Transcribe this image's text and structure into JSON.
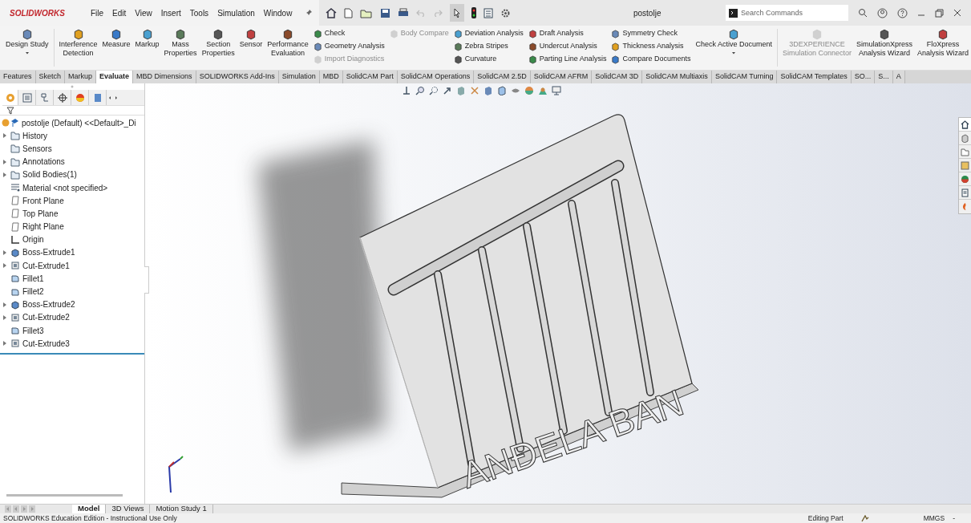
{
  "app": {
    "logo": "SOLIDWORKS",
    "menus": [
      "File",
      "Edit",
      "View",
      "Insert",
      "Tools",
      "Simulation",
      "Window"
    ],
    "title": "postolje",
    "search": {
      "placeholder": "Search Commands"
    }
  },
  "ribbon": [
    {
      "kind": "large",
      "lines": [
        "Design Study"
      ],
      "dropdown": true,
      "disabled": false
    },
    {
      "kind": "large",
      "lines": [
        "Interference",
        "Detection"
      ],
      "dropdown": false,
      "disabled": false
    },
    {
      "kind": "large",
      "lines": [
        "Measure"
      ],
      "dropdown": false,
      "disabled": false
    },
    {
      "kind": "large",
      "lines": [
        "Markup"
      ],
      "dropdown": false,
      "disabled": false
    },
    {
      "kind": "large",
      "lines": [
        "Mass",
        "Properties"
      ],
      "dropdown": false,
      "disabled": false
    },
    {
      "kind": "large",
      "lines": [
        "Section",
        "Properties"
      ],
      "dropdown": false,
      "disabled": false
    },
    {
      "kind": "large",
      "lines": [
        "Sensor"
      ],
      "dropdown": false,
      "disabled": false
    },
    {
      "kind": "large",
      "lines": [
        "Performance",
        "Evaluation"
      ],
      "dropdown": false,
      "disabled": false
    },
    {
      "kind": "column",
      "items": [
        {
          "label": "Check",
          "disabled": false
        },
        {
          "label": "Geometry Analysis",
          "disabled": false
        },
        {
          "label": "Import Diagnostics",
          "disabled": true
        }
      ]
    },
    {
      "kind": "column",
      "items": [
        {
          "label": "Body Compare",
          "disabled": true
        }
      ]
    },
    {
      "kind": "column",
      "items": [
        {
          "label": "Deviation Analysis",
          "disabled": false
        },
        {
          "label": "Zebra Stripes",
          "disabled": false
        },
        {
          "label": "Curvature",
          "disabled": false
        }
      ]
    },
    {
      "kind": "column",
      "items": [
        {
          "label": "Draft Analysis",
          "disabled": false
        },
        {
          "label": "Undercut Analysis",
          "disabled": false
        },
        {
          "label": "Parting Line Analysis",
          "disabled": false
        }
      ]
    },
    {
      "kind": "column",
      "items": [
        {
          "label": "Symmetry Check",
          "disabled": false
        },
        {
          "label": "Thickness Analysis",
          "disabled": false
        },
        {
          "label": "Compare Documents",
          "disabled": false
        }
      ]
    },
    {
      "kind": "large",
      "lines": [
        "Check Active Document"
      ],
      "dropdown": true,
      "disabled": false
    },
    {
      "kind": "large",
      "lines": [
        "3DEXPERIENCE",
        "Simulation Connector"
      ],
      "dropdown": false,
      "disabled": true
    },
    {
      "kind": "large",
      "lines": [
        "SimulationXpress",
        "Analysis Wizard"
      ],
      "dropdown": false,
      "disabled": false
    },
    {
      "kind": "large",
      "lines": [
        "FloXpress",
        "Analysis Wizard"
      ],
      "dropdown": false,
      "disabled": false
    }
  ],
  "tabs": [
    {
      "label": "Features",
      "selected": false
    },
    {
      "label": "Sketch",
      "selected": false
    },
    {
      "label": "Markup",
      "selected": false
    },
    {
      "label": "Evaluate",
      "selected": true
    },
    {
      "label": "MBD Dimensions",
      "selected": false
    },
    {
      "label": "SOLIDWORKS Add-Ins",
      "selected": false
    },
    {
      "label": "Simulation",
      "selected": false
    },
    {
      "label": "MBD",
      "selected": false
    },
    {
      "label": "SolidCAM Part",
      "selected": false
    },
    {
      "label": "SolidCAM Operations",
      "selected": false
    },
    {
      "label": "SolidCAM 2.5D",
      "selected": false
    },
    {
      "label": "SolidCAM AFRM",
      "selected": false
    },
    {
      "label": "SolidCAM 3D",
      "selected": false
    },
    {
      "label": "SolidCAM Multiaxis",
      "selected": false
    },
    {
      "label": "SolidCAM Turning",
      "selected": false
    },
    {
      "label": "SolidCAM Templates",
      "selected": false
    },
    {
      "label": "SO...",
      "selected": false
    },
    {
      "label": "S...",
      "selected": false
    },
    {
      "label": "A",
      "selected": false
    }
  ],
  "feature_tree": {
    "root": "postolje (Default) <<Default>_Di",
    "items": [
      {
        "label": "History",
        "kind": "folder",
        "expandable": true
      },
      {
        "label": "Sensors",
        "kind": "folder",
        "expandable": false
      },
      {
        "label": "Annotations",
        "kind": "folder",
        "expandable": true
      },
      {
        "label": "Solid Bodies(1)",
        "kind": "folder",
        "expandable": true
      },
      {
        "label": "Material <not specified>",
        "kind": "material",
        "expandable": false
      },
      {
        "label": "Front Plane",
        "kind": "plane",
        "expandable": false
      },
      {
        "label": "Top Plane",
        "kind": "plane",
        "expandable": false
      },
      {
        "label": "Right Plane",
        "kind": "plane",
        "expandable": false
      },
      {
        "label": "Origin",
        "kind": "origin",
        "expandable": false
      },
      {
        "label": "Boss-Extrude1",
        "kind": "boss",
        "expandable": true
      },
      {
        "label": "Cut-Extrude1",
        "kind": "cut",
        "expandable": true
      },
      {
        "label": "Fillet1",
        "kind": "fillet",
        "expandable": false
      },
      {
        "label": "Fillet2",
        "kind": "fillet",
        "expandable": false
      },
      {
        "label": "Boss-Extrude2",
        "kind": "boss",
        "expandable": true
      },
      {
        "label": "Cut-Extrude2",
        "kind": "cut",
        "expandable": true
      },
      {
        "label": "Fillet3",
        "kind": "fillet",
        "expandable": false
      },
      {
        "label": "Cut-Extrude3",
        "kind": "cut",
        "expandable": true
      }
    ]
  },
  "viewport": {
    "model_text": "ANĐELA BAN"
  },
  "bottom_tabs": [
    {
      "label": "Model",
      "selected": true
    },
    {
      "label": "3D Views",
      "selected": false
    },
    {
      "label": "Motion Study 1",
      "selected": false
    }
  ],
  "status_bar": {
    "message": "SOLIDWORKS Education Edition - Instructional Use Only",
    "mode": "Editing Part",
    "units": "MMGS",
    "units_caret": "-"
  }
}
